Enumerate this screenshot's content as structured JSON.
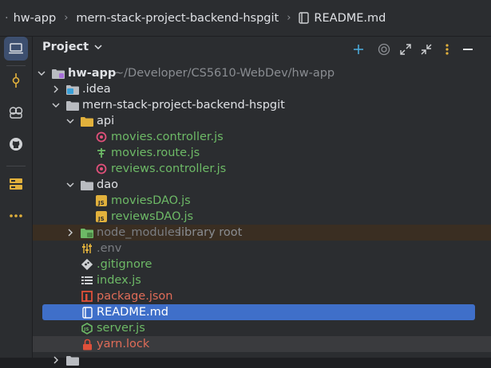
{
  "breadcrumb": {
    "items": [
      "hw-app",
      "mern-stack-project-backend-hspgit",
      "README.md"
    ]
  },
  "panel": {
    "title": "Project"
  },
  "tree": {
    "root": {
      "name": "hw-app",
      "path": "~/Developer/CS5610-WebDev/hw-app"
    },
    "idea": ".idea",
    "backend": "mern-stack-project-backend-hspgit",
    "api": "api",
    "movies_controller": "movies.controller.js",
    "movies_route": "movies.route.js",
    "reviews_controller": "reviews.controller.js",
    "dao": "dao",
    "movies_dao": "moviesDAO.js",
    "reviews_dao": "reviewsDAO.js",
    "node_modules": "node_modules",
    "node_modules_hint": "library root",
    "env": ".env",
    "gitignore": ".gitignore",
    "index": "index.js",
    "package": "package.json",
    "readme": "README.md",
    "server": "server.js",
    "yarn": "yarn.lock"
  },
  "colors": {
    "accent": "#3f6fc9",
    "modified": "#6db966",
    "conflict": "#e06c58"
  }
}
